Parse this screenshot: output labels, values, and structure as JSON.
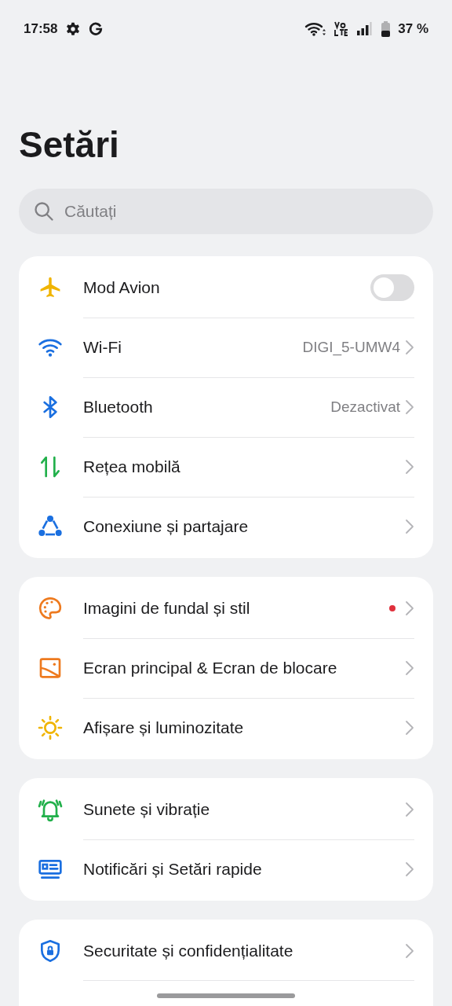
{
  "status_bar": {
    "time": "17:58",
    "battery": "37 %"
  },
  "title": "Setări",
  "search": {
    "placeholder": "Căutați"
  },
  "groups": [
    {
      "items": [
        {
          "kind": "toggle",
          "label": "Mod Avion",
          "on": false,
          "dot": false
        },
        {
          "kind": "link",
          "label": "Wi-Fi",
          "value": "DIGI_5-UMW4",
          "dot": false
        },
        {
          "kind": "link",
          "label": "Bluetooth",
          "value": "Dezactivat",
          "dot": false
        },
        {
          "kind": "link",
          "label": "Rețea mobilă",
          "dot": false
        },
        {
          "kind": "link",
          "label": "Conexiune și partajare",
          "dot": false
        }
      ]
    },
    {
      "items": [
        {
          "kind": "link",
          "label": "Imagini de fundal și stil",
          "dot": true
        },
        {
          "kind": "link",
          "label": "Ecran principal & Ecran de blocare",
          "dot": false
        },
        {
          "kind": "link",
          "label": "Afișare și luminozitate",
          "dot": false
        }
      ]
    },
    {
      "items": [
        {
          "kind": "link",
          "label": "Sunete și vibrație",
          "dot": false
        },
        {
          "kind": "link",
          "label": "Notificări și Setări rapide",
          "dot": false
        }
      ]
    },
    {
      "items": [
        {
          "kind": "link",
          "label": "Securitate și confidențialitate",
          "dot": false
        }
      ]
    }
  ]
}
